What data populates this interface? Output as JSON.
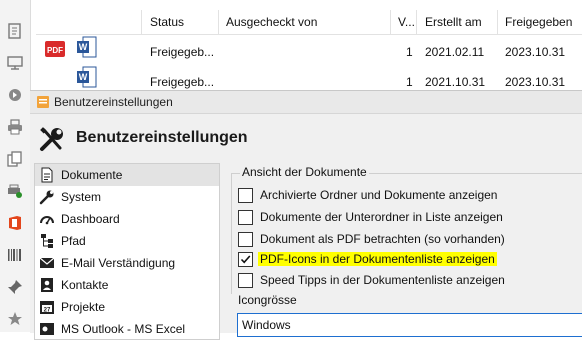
{
  "toolbar": {
    "icons": [
      "notes-icon",
      "monitor-icon",
      "logout-icon",
      "printer-icon",
      "copy-icon",
      "print-settings-icon",
      "office-icon",
      "barcode-icon",
      "pin-icon",
      "star-icon"
    ]
  },
  "doclist": {
    "columns": [
      "Status",
      "Ausgecheckt von",
      "V...",
      "Erstellt am",
      "Freigegeben"
    ],
    "rows": [
      {
        "status": "Freigegeb...",
        "version": "1",
        "created": "2021.02.11",
        "released": "2023.10.31"
      },
      {
        "status": "Freigegeb...",
        "version": "1",
        "created": "2021.10.31",
        "released": "2023.10.31"
      }
    ]
  },
  "dialog": {
    "title": "Benutzereinstellungen",
    "heading": "Benutzereinstellungen",
    "categories": [
      {
        "label": "Dokumente",
        "icon": "document-icon",
        "selected": true
      },
      {
        "label": "System",
        "icon": "wrench-icon",
        "selected": false
      },
      {
        "label": "Dashboard",
        "icon": "dashboard-icon",
        "selected": false
      },
      {
        "label": "Pfad",
        "icon": "tree-icon",
        "selected": false
      },
      {
        "label": "E-Mail Verständigung",
        "icon": "email-icon",
        "selected": false
      },
      {
        "label": "Kontakte",
        "icon": "contacts-icon",
        "selected": false
      },
      {
        "label": "Projekte",
        "icon": "calendar-icon",
        "selected": false
      },
      {
        "label": "MS Outlook - MS Excel",
        "icon": "outlook-icon",
        "selected": false
      }
    ],
    "section_title": "Ansicht der Dokumente",
    "options": [
      {
        "label": "Archivierte Ordner und Dokumente anzeigen",
        "checked": false
      },
      {
        "label": "Dokumente der Unterordner in Liste anzeigen",
        "checked": false
      },
      {
        "label": "Dokument als PDF betrachten (so vorhanden)",
        "checked": false
      },
      {
        "label": "PDF-Icons in der Dokumentenliste anzeigen",
        "checked": true
      },
      {
        "label": "Speed Tipps in der Dokumentenliste anzeigen",
        "checked": false
      }
    ],
    "iconsize_label": "Icongrösse",
    "iconsize_value": "Windows"
  },
  "colors": {
    "accent": "#1e6fd0",
    "highlight": "#ffff00",
    "pdf_red": "#d92b2b",
    "word_blue": "#2b579a"
  }
}
